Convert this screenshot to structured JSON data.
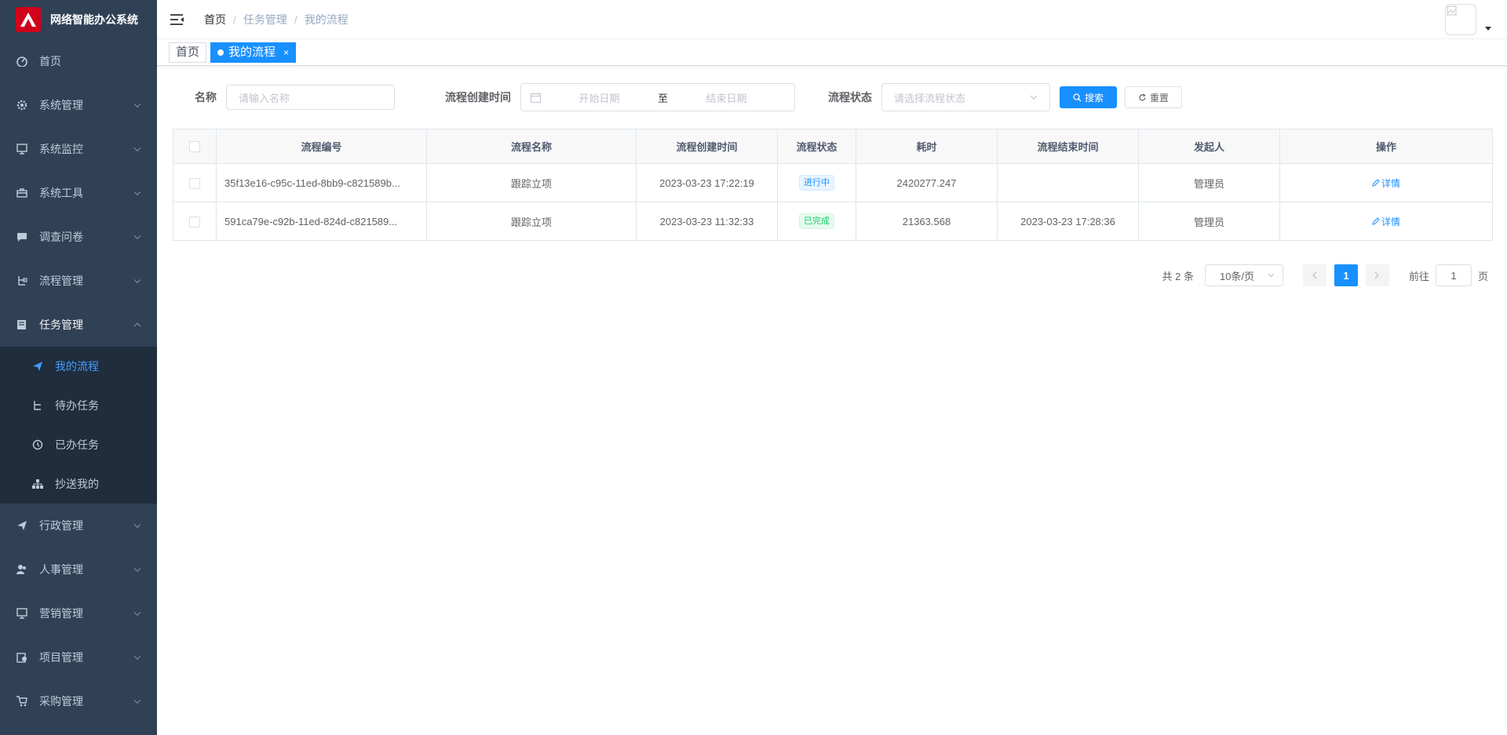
{
  "app": {
    "title": "网络智能办公系统"
  },
  "sidebar": {
    "items": [
      {
        "label": "首页",
        "icon": "dashboard-icon"
      },
      {
        "label": "系统管理",
        "icon": "gear-icon"
      },
      {
        "label": "系统监控",
        "icon": "monitor-icon"
      },
      {
        "label": "系统工具",
        "icon": "toolbox-icon"
      },
      {
        "label": "调查问卷",
        "icon": "chat-icon"
      },
      {
        "label": "流程管理",
        "icon": "tree-icon"
      },
      {
        "label": "任务管理",
        "icon": "task-icon"
      }
    ],
    "sub_items": [
      {
        "label": "我的流程",
        "icon": "paper-plane-icon"
      },
      {
        "label": "待办任务",
        "icon": "tree-icon"
      },
      {
        "label": "已办任务",
        "icon": "history-icon"
      },
      {
        "label": "抄送我的",
        "icon": "org-chart-icon"
      }
    ],
    "bottom_items": [
      {
        "label": "行政管理",
        "icon": "paper-plane-icon"
      },
      {
        "label": "人事管理",
        "icon": "people-icon"
      },
      {
        "label": "营销管理",
        "icon": "monitor-icon"
      },
      {
        "label": "项目管理",
        "icon": "project-icon"
      },
      {
        "label": "采购管理",
        "icon": "cart-icon"
      }
    ]
  },
  "navbar": {
    "breadcrumb": [
      "首页",
      "任务管理",
      "我的流程"
    ],
    "separator": "/"
  },
  "tags": [
    {
      "label": "首页"
    },
    {
      "label": "我的流程",
      "close": "×"
    }
  ],
  "search": {
    "name_label": "名称",
    "name_placeholder": "请输入名称",
    "date_label": "流程创建时间",
    "start_placeholder": "开始日期",
    "range_sep": "至",
    "end_placeholder": "结束日期",
    "status_label": "流程状态",
    "status_placeholder": "请选择流程状态",
    "search_btn": "搜索",
    "reset_btn": "重置"
  },
  "table": {
    "headers": [
      "流程编号",
      "流程名称",
      "流程创建时间",
      "流程状态",
      "耗时",
      "流程结束时间",
      "发起人",
      "操作"
    ],
    "rows": [
      {
        "id": "35f13e16-c95c-11ed-8bb9-c821589b...",
        "name": "跟踪立项",
        "created": "2023-03-23 17:22:19",
        "status": "进行中",
        "status_color": "#1890ff",
        "duration": "2420277.247",
        "ended": "",
        "initiator": "管理员",
        "action": "详情"
      },
      {
        "id": "591ca79e-c92b-11ed-824d-c821589...",
        "name": "跟踪立项",
        "created": "2023-03-23 11:32:33",
        "status": "已完成",
        "status_color": "#13ce66",
        "duration": "21363.568",
        "ended": "2023-03-23 17:28:36",
        "initiator": "管理员",
        "action": "详情"
      }
    ]
  },
  "pagination": {
    "total": "共 2 条",
    "page_size": "10条/页",
    "current": "1",
    "goto_label": "前往",
    "goto_value": "1",
    "page_unit": "页"
  },
  "colors": {
    "sidebar_bg": "#304156",
    "submenu_bg": "#1f2d3d",
    "accent": "#1890ff",
    "logo_red": "#d0021b"
  }
}
